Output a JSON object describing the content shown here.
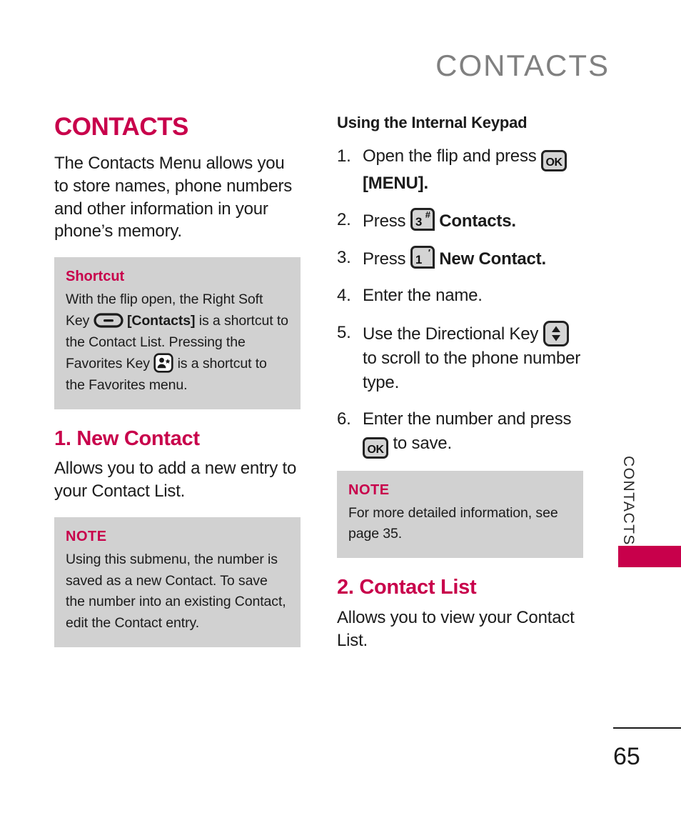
{
  "running_head": "CONTACTS",
  "left_column": {
    "chapter_title": "CONTACTS",
    "intro": "The Contacts Menu allows you to store names, phone numbers and other information in your phone’s memory.",
    "shortcut_box": {
      "label": "Shortcut",
      "text_part1": "With the flip open, the Right Soft Key",
      "bracket_label": "[Contacts]",
      "text_part2": "is a shortcut to the Contact List.",
      "text_part3": "Pressing the Favorites Key",
      "text_part4": "is a shortcut to the Favorites menu.",
      "softkey_icon": "soft-key-icon",
      "favorites_icon": "favorites-key-icon"
    },
    "section_1": {
      "title": "1. New Contact",
      "body": "Allows you to add a new entry to your Contact List."
    },
    "note_box": {
      "label": "NOTE",
      "text": "Using this submenu, the number is saved as a new Contact. To save the number into an existing Contact, edit the Contact entry."
    }
  },
  "right_column": {
    "sub_title": "Using the Internal Keypad",
    "steps": [
      {
        "num": "1.",
        "text_before": "Open the flip and press",
        "key": "OK",
        "text_after": "[MENU].",
        "after_bold": true
      },
      {
        "num": "2.",
        "text_before": "Press",
        "key_digit": "3",
        "key_sup": "#",
        "text_after": "Contacts.",
        "after_bold": true
      },
      {
        "num": "3.",
        "text_before": "Press",
        "key_digit": "1",
        "key_sup": "′",
        "text_after": "New Contact.",
        "after_bold": true
      },
      {
        "num": "4.",
        "text_before": "Enter the name.",
        "text_after": "",
        "after_bold": false
      },
      {
        "num": "5.",
        "text_before": "Use the Directional Key",
        "key": "directional",
        "text_after": "to scroll to the phone number type.",
        "after_bold": false
      },
      {
        "num": "6.",
        "text_before": "Enter the number and press",
        "key": "OK",
        "text_after": "to save.",
        "after_bold": false
      }
    ],
    "note_box": {
      "label": "NOTE",
      "text": "For more detailed information, see page 35."
    },
    "section_2": {
      "title": "2. Contact List",
      "body": "Allows you to view your Contact List."
    }
  },
  "thumb_tab": {
    "label": "CONTACTS",
    "accent_color": "#C8004B"
  },
  "folio": {
    "page_number": "65"
  },
  "colors": {
    "accent": "#C8004B",
    "callout_bg": "#D1D1D1",
    "running_head": "#808080",
    "body_text": "#1B1B1B"
  }
}
